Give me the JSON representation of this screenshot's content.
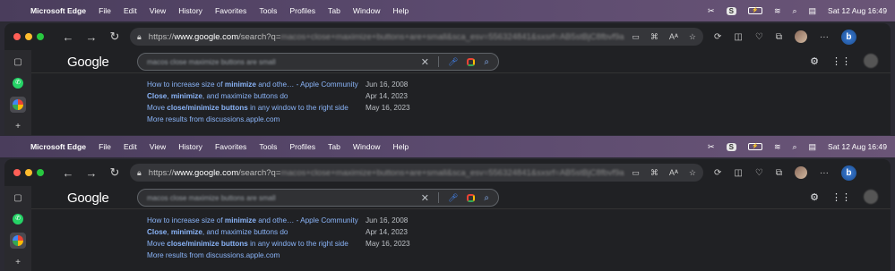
{
  "menubar": {
    "app": "Microsoft Edge",
    "items": [
      "File",
      "Edit",
      "View",
      "History",
      "Favorites",
      "Tools",
      "Profiles",
      "Tab",
      "Window",
      "Help"
    ],
    "status_pill": "S",
    "clock": "Sat 12 Aug  16:49"
  },
  "toolbar": {
    "url_prefix": "https://",
    "url_host": "www.google.com",
    "url_path": "/search?q=",
    "url_blurred": "macos+close+maximize+buttons+are+small&sca_esv=556324841&sxsrf=AB5stBjC8fbvf9a"
  },
  "google": {
    "logo": "Google",
    "query": "macos close maximize buttons are small"
  },
  "results": [
    {
      "pre": "How to increase size of ",
      "bold1": "minimize",
      "mid": " and othe… - Apple Community",
      "bold2": "",
      "post": "",
      "date": "Jun 16, 2008"
    },
    {
      "pre": "",
      "bold1": "Close",
      "mid": ", ",
      "bold2": "minimize",
      "post": ", and maximize buttons do",
      "date": "Apr 14, 2023"
    },
    {
      "pre": "Move ",
      "bold1": "close/minimize buttons",
      "mid": " in any window to the right side",
      "bold2": "",
      "post": "",
      "date": "May 16, 2023"
    }
  ],
  "more_results": "More results from discussions.apple.com"
}
